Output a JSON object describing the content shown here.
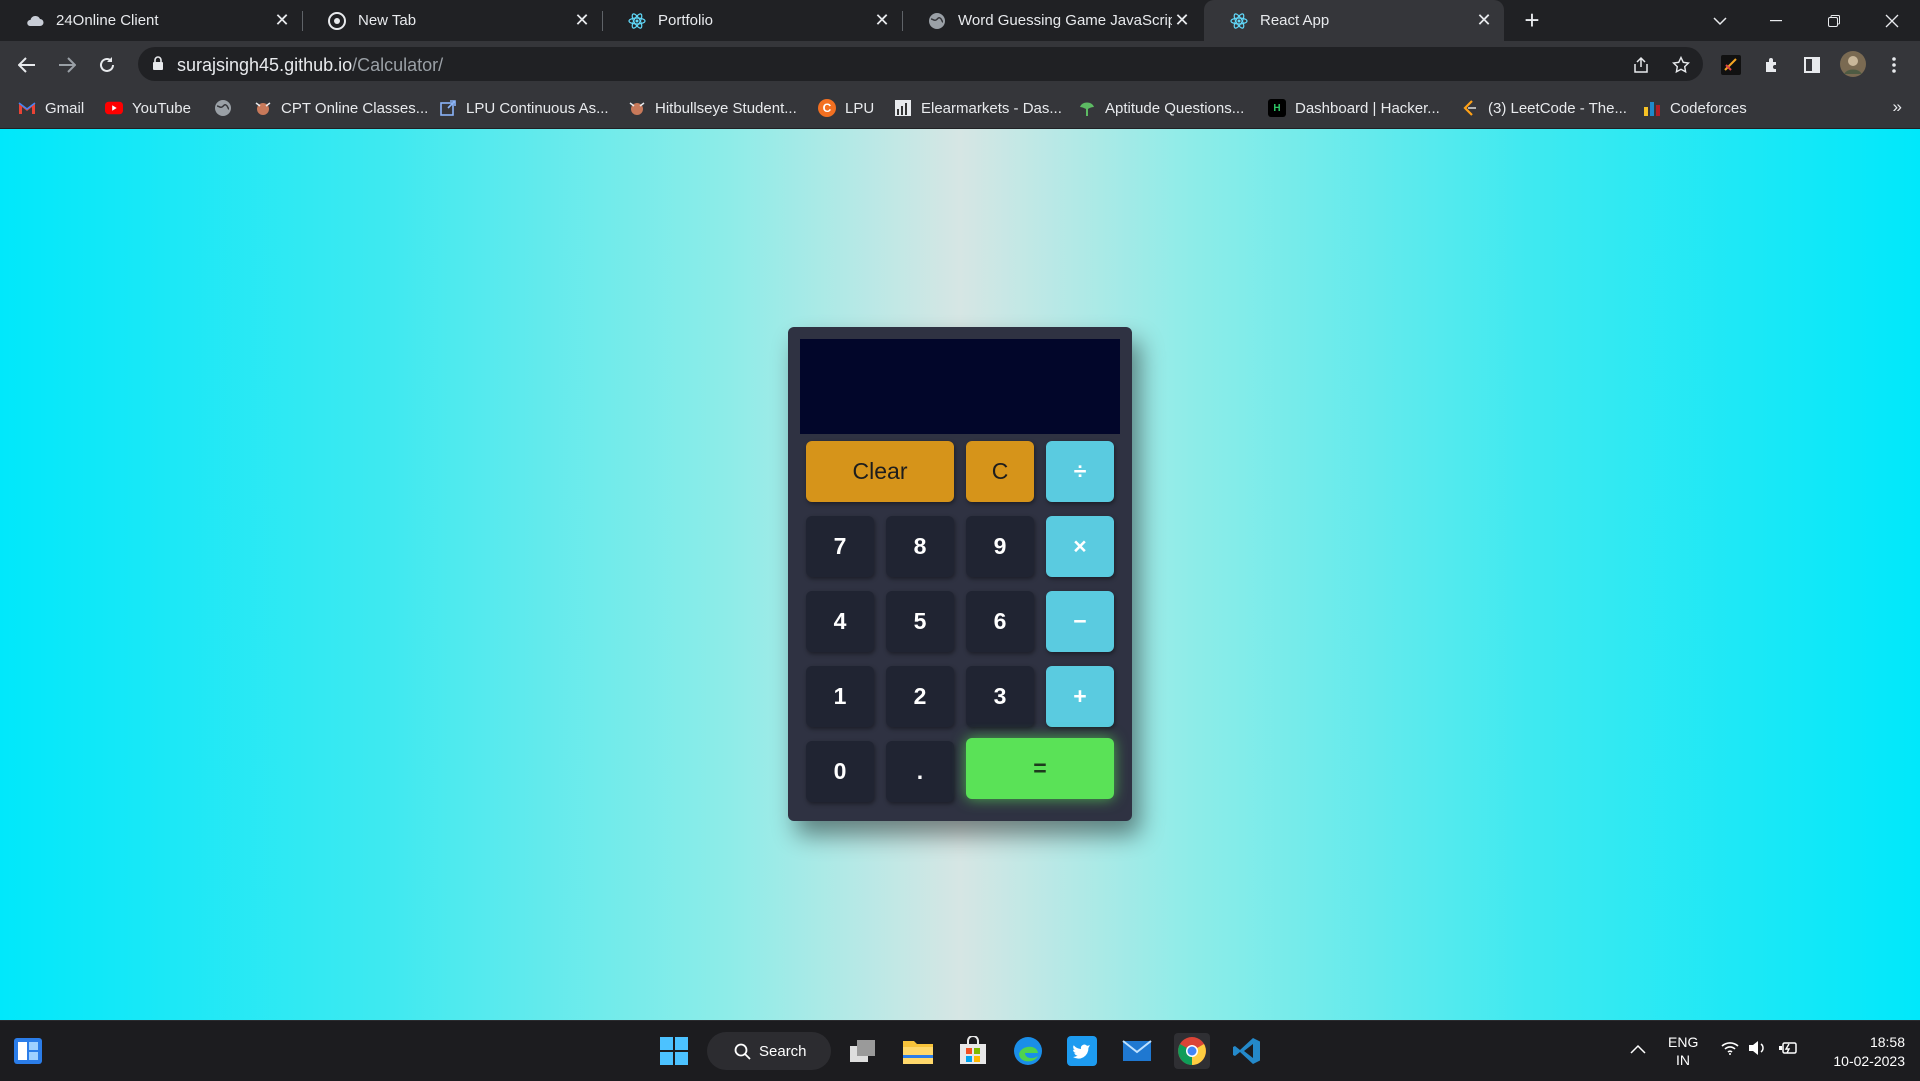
{
  "browser": {
    "tabs": [
      {
        "title": "24Online Client",
        "icon": "cloud-icon"
      },
      {
        "title": "New Tab",
        "icon": "chrome-icon"
      },
      {
        "title": "Portfolio",
        "icon": "react-icon"
      },
      {
        "title": "Word Guessing Game JavaScript",
        "icon": "globe-icon"
      },
      {
        "title": "React App",
        "icon": "react-icon"
      }
    ],
    "active_tab_index": 4,
    "url_host": "surajsingh45.github.io",
    "url_path": "/Calculator/",
    "bookmarks": [
      {
        "label": "Gmail",
        "icon": "gmail-icon"
      },
      {
        "label": "YouTube",
        "icon": "youtube-icon"
      },
      {
        "label": "",
        "icon": "globe-icon"
      },
      {
        "label": "CPT Online Classes...",
        "icon": "bull-icon"
      },
      {
        "label": "LPU Continuous As...",
        "icon": "external-link-icon"
      },
      {
        "label": "Hitbullseye Student...",
        "icon": "bull-icon"
      },
      {
        "label": "LPU",
        "icon": "lpu-icon"
      },
      {
        "label": "Elearmarkets - Das...",
        "icon": "chart-icon"
      },
      {
        "label": "Aptitude Questions...",
        "icon": "leaf-icon"
      },
      {
        "label": "Dashboard | Hacker...",
        "icon": "hackerrank-icon"
      },
      {
        "label": "(3) LeetCode - The...",
        "icon": "leetcode-icon"
      },
      {
        "label": "Codeforces",
        "icon": "codeforces-icon"
      }
    ],
    "bookmarks_more": "»"
  },
  "calculator": {
    "display_value": "",
    "keys": {
      "clear": "Clear",
      "backspace": "C",
      "divide": "÷",
      "seven": "7",
      "eight": "8",
      "nine": "9",
      "multiply": "×",
      "four": "4",
      "five": "5",
      "six": "6",
      "subtract": "−",
      "one": "1",
      "two": "2",
      "three": "3",
      "add": "+",
      "zero": "0",
      "decimal": ".",
      "equals": "="
    },
    "colors": {
      "function_key": "#d6941a",
      "operator_key": "#5acbe0",
      "equals_key": "#5ae257",
      "number_key": "#202432",
      "display_bg": "#02062a"
    }
  },
  "taskbar": {
    "search_label": "Search",
    "language": "ENG",
    "region": "IN",
    "time": "18:58",
    "date": "10-02-2023"
  }
}
